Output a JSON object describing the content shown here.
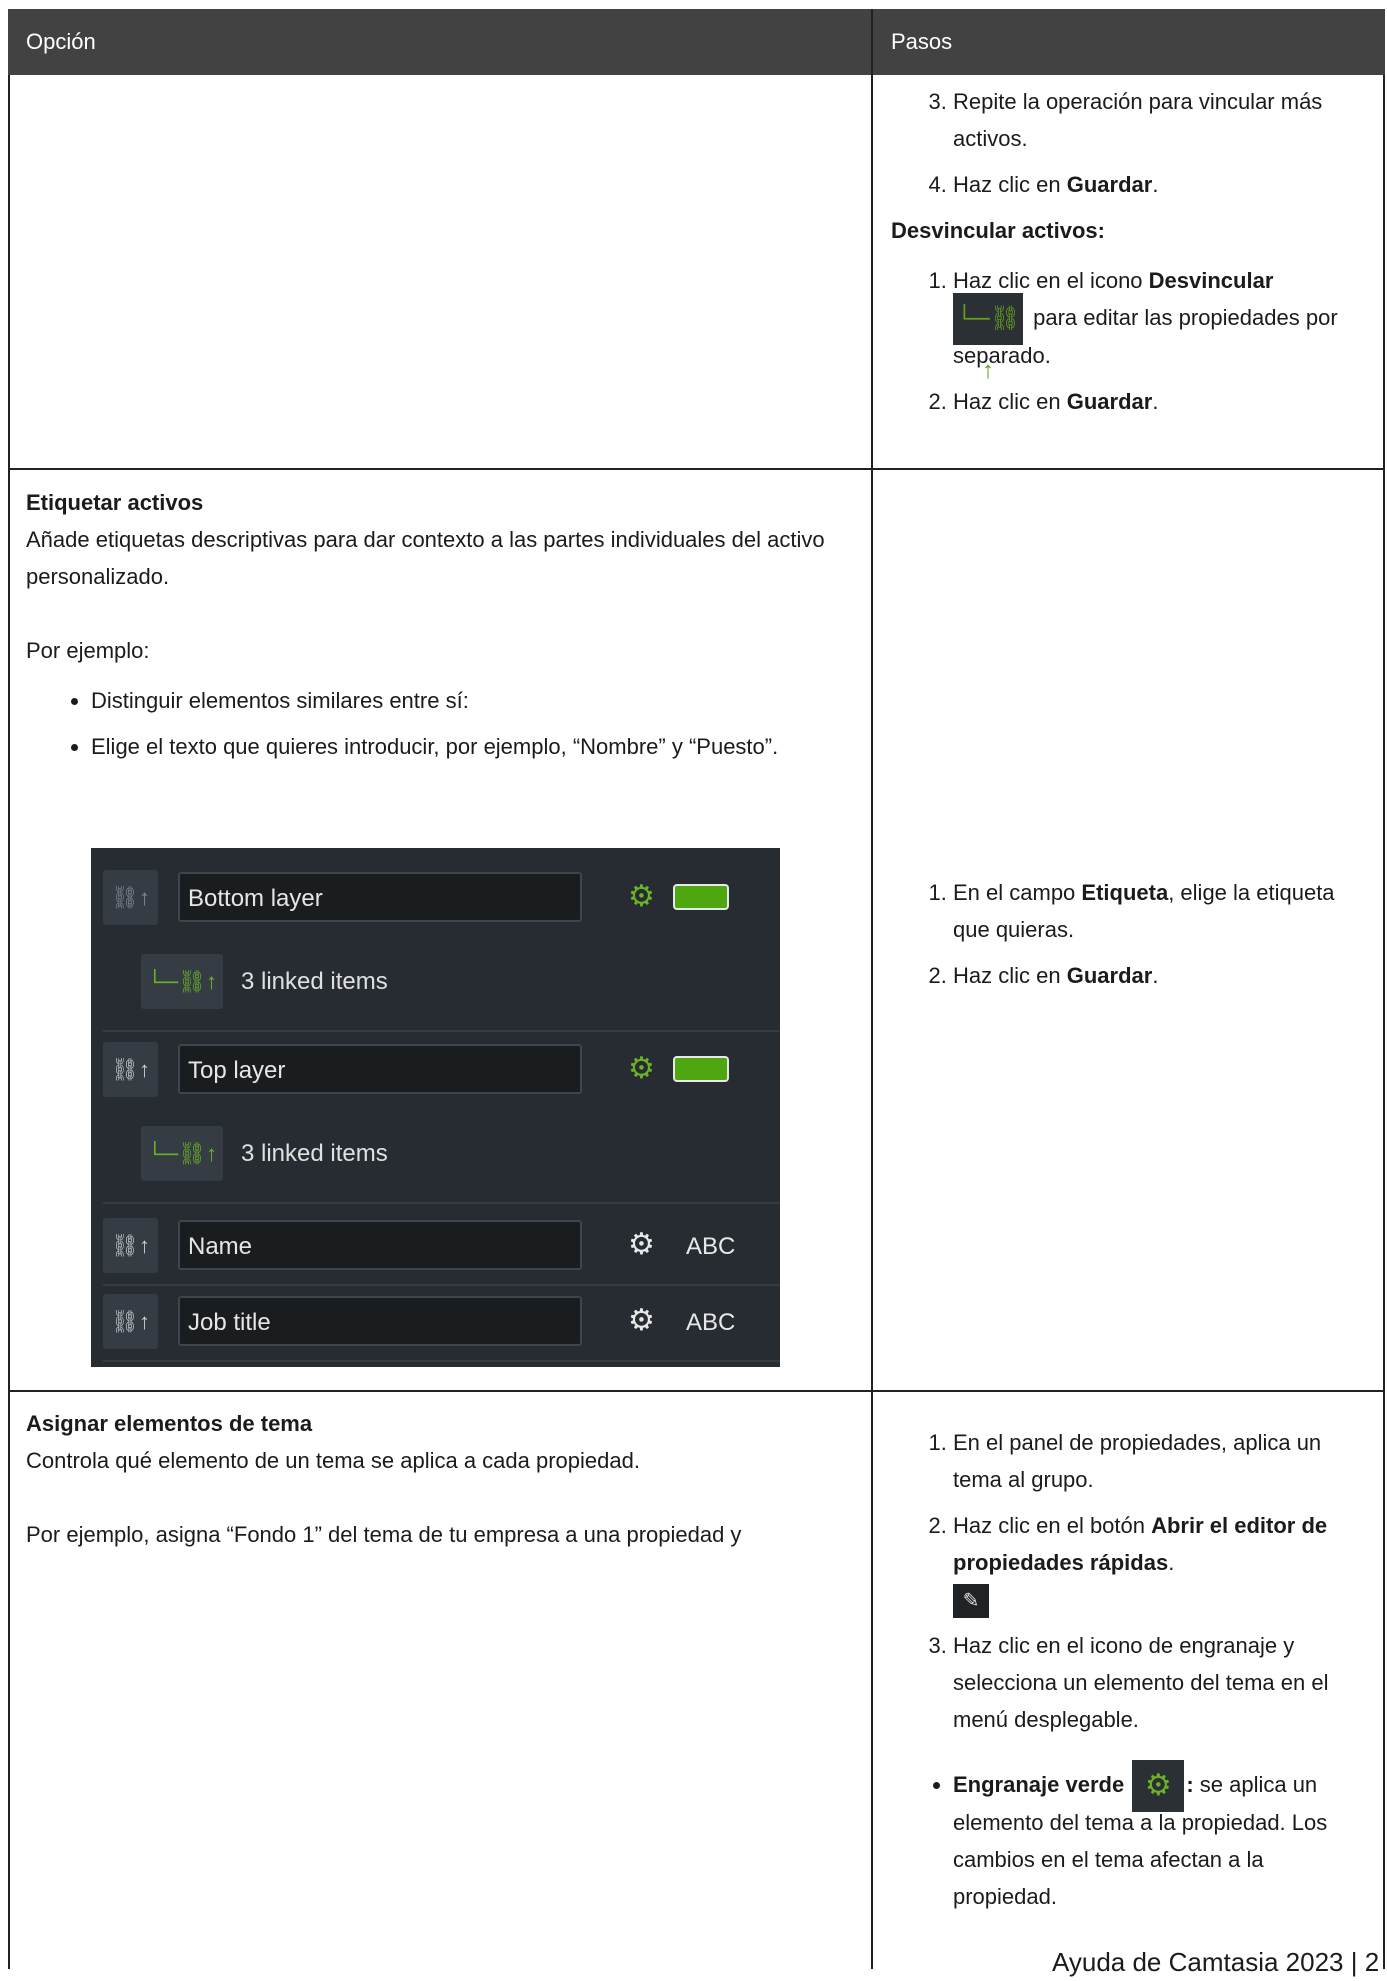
{
  "header": {
    "col1": "Opción",
    "col2": "Pasos"
  },
  "row_link": {
    "steps_cont": [
      {
        "num": "3.",
        "text": "Repite la operación para vincular más activos."
      },
      {
        "num": "4.",
        "pre": "Haz clic en ",
        "bold": "Guardar",
        "post": "."
      }
    ],
    "unlink_heading": "Desvincular activos:",
    "unlink_step1_pre": "Haz clic en el icono ",
    "unlink_step1_bold": "Desvincular",
    "unlink_step1_post": " para editar las propiedades por separado.",
    "unlink_step2_pre": "Haz clic en ",
    "unlink_step2_bold": "Guardar",
    "unlink_step2_post": "."
  },
  "row_tag": {
    "title": "Etiquetar activos",
    "desc": "Añade etiquetas descriptivas para dar contexto a las partes individuales del activo personalizado.",
    "example_intro": "Por ejemplo:",
    "bullets": [
      "Distinguir elementos similares entre sí:",
      "Elige el texto que quieres introducir, por ejemplo, “Nombre” y “Puesto”."
    ],
    "panel": {
      "rows": [
        {
          "field": "Bottom layer",
          "linked": "3 linked items"
        },
        {
          "field": "Top layer",
          "linked": "3 linked items"
        },
        {
          "field": "Name",
          "value": "ABC"
        },
        {
          "field": "Job title",
          "value": "ABC"
        }
      ]
    },
    "step1_pre": "En el campo ",
    "step1_bold": "Etiqueta",
    "step1_post": ", elige la etiqueta que quieras.",
    "step2_pre": "Haz clic en ",
    "step2_bold": "Guardar",
    "step2_post": "."
  },
  "row_theme": {
    "title": "Asignar elementos de tema",
    "desc": "Controla qué elemento de un tema se aplica a cada propiedad.",
    "example": "Por ejemplo, asigna “Fondo 1” del tema de tu empresa a una propiedad y",
    "step1": "En el panel de propiedades, aplica un tema al grupo.",
    "step2_pre": "Haz clic en el botón ",
    "step2_bold": "Abrir el editor de propiedades rápidas",
    "step2_post": ".",
    "step3": "Haz clic en el icono de engranaje y selecciona un elemento del tema en el menú desplegable.",
    "bullet_bold": "Engranaje verde",
    "bullet_colon": ":",
    "bullet_text": " se aplica un elemento del tema a la propiedad. Los cambios en el tema afectan a la propiedad."
  },
  "footer": "Ayuda de Camtasia 2023 | 2",
  "colors": {
    "header_bg": "#424242",
    "panel_bg": "#262c32",
    "accent_green": "#6cb227"
  },
  "icons": [
    "link-icon",
    "unlink-icon",
    "gear-icon",
    "edit-properties-icon"
  ]
}
